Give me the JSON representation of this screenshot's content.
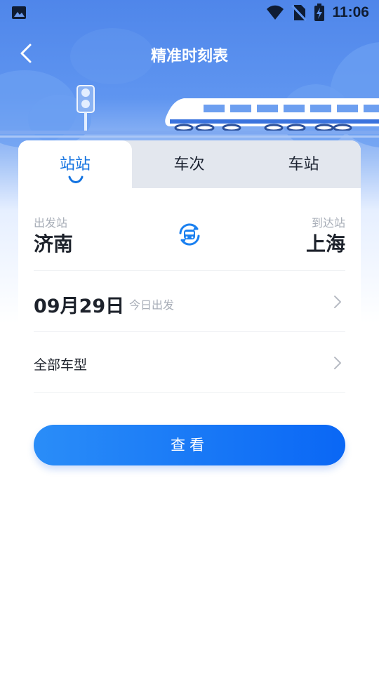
{
  "status_bar": {
    "time": "11:06",
    "icons": [
      "image-icon",
      "wifi-icon",
      "no-sim-icon",
      "battery-charging-icon"
    ]
  },
  "header": {
    "title": "精准时刻表",
    "back_icon": "chevron-left-icon"
  },
  "tabs": [
    {
      "label": "站站",
      "active": true
    },
    {
      "label": "车次",
      "active": false
    },
    {
      "label": "车站",
      "active": false
    }
  ],
  "stations": {
    "from_label": "出发站",
    "from": "济南",
    "to_label": "到达站",
    "to": "上海",
    "swap_icon": "swap-train-icon"
  },
  "date": {
    "value": "09月29日",
    "subtitle": "今日出发"
  },
  "train_type": {
    "value": "全部车型"
  },
  "search_button": {
    "label": "查看"
  },
  "colors": {
    "accent": "#1272e0",
    "button_start": "#2a8df8",
    "button_end": "#0a67f5",
    "header_bg": "#4f86ea"
  }
}
